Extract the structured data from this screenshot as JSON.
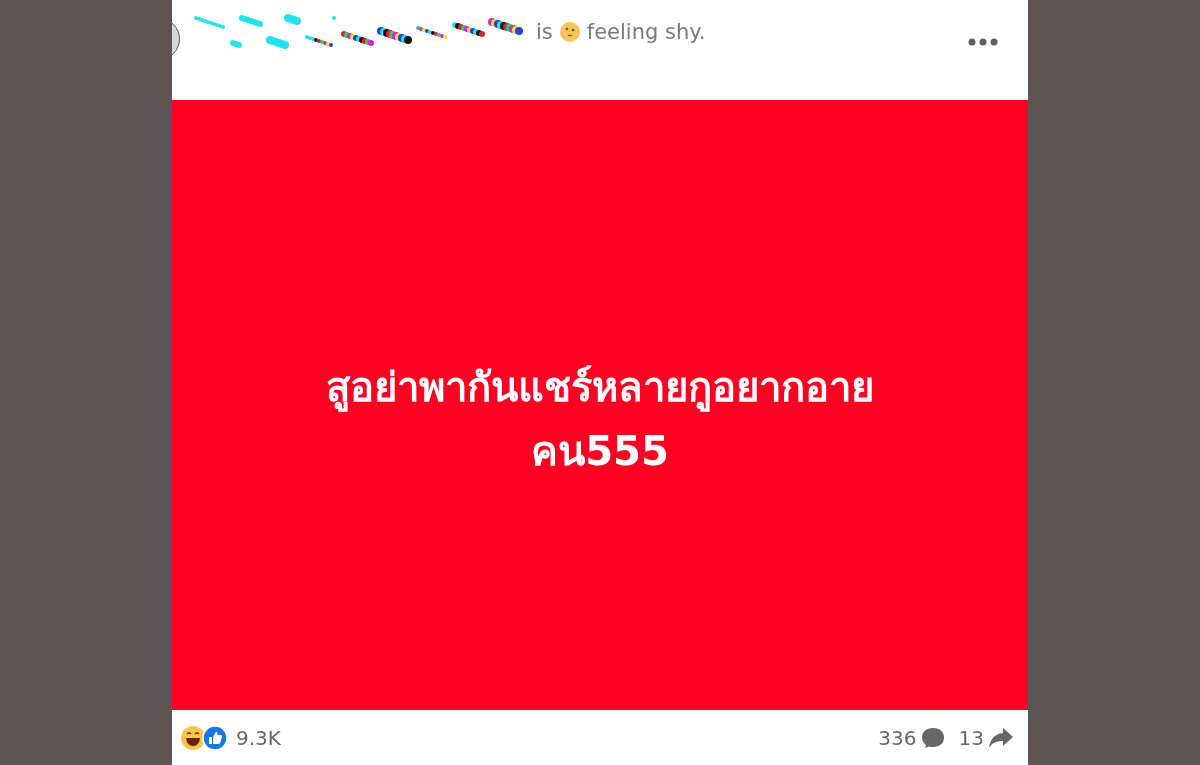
{
  "post": {
    "header": {
      "verb": "is",
      "feeling": "feeling shy."
    },
    "content": {
      "lines": [
        "สูอย่าพากันแชร์หลายกูอยากอาย",
        "คน555"
      ]
    },
    "footer": {
      "reaction_count": "9.3K",
      "comment_count": "336",
      "share_count": "13"
    }
  }
}
